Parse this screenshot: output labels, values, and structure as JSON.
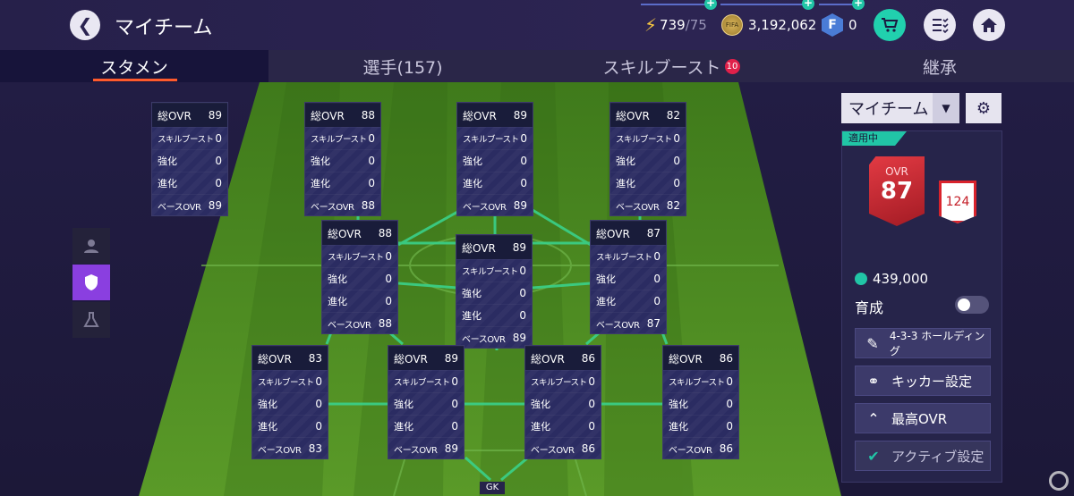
{
  "header": {
    "back_icon": "chevron-left-icon",
    "title": "マイチーム",
    "energy": "739",
    "energy_max": "/75",
    "coins": "3,192,062",
    "coin_icon_text": "FIFA",
    "fp_icon_text": "F",
    "fp": "0",
    "shop_icon": "cart-icon",
    "list_icon": "checklist-icon",
    "home_icon": "home-icon"
  },
  "tabs": [
    {
      "label": "スタメン",
      "badge": ""
    },
    {
      "label": "選手(157)",
      "badge": ""
    },
    {
      "label": "スキルブースト",
      "badge": "10"
    },
    {
      "label": "継承",
      "badge": ""
    }
  ],
  "card_labels": {
    "ovr": "総OVR",
    "skill": "スキルブースト",
    "enhance": "強化",
    "evolve": "進化",
    "base": "ベースOVR"
  },
  "players": [
    {
      "ovr": "89",
      "skill": "0",
      "enhance": "0",
      "evolve": "0",
      "base": "89"
    },
    {
      "ovr": "88",
      "skill": "0",
      "enhance": "0",
      "evolve": "0",
      "base": "88"
    },
    {
      "ovr": "89",
      "skill": "0",
      "enhance": "0",
      "evolve": "0",
      "base": "89"
    },
    {
      "ovr": "82",
      "skill": "0",
      "enhance": "0",
      "evolve": "0",
      "base": "82"
    },
    {
      "ovr": "88",
      "skill": "0",
      "enhance": "0",
      "evolve": "0",
      "base": "88"
    },
    {
      "ovr": "89",
      "skill": "0",
      "enhance": "0",
      "evolve": "0",
      "base": "89"
    },
    {
      "ovr": "87",
      "skill": "0",
      "enhance": "0",
      "evolve": "0",
      "base": "87"
    },
    {
      "ovr": "83",
      "skill": "0",
      "enhance": "0",
      "evolve": "0",
      "base": "83"
    },
    {
      "ovr": "89",
      "skill": "0",
      "enhance": "0",
      "evolve": "0",
      "base": "89"
    },
    {
      "ovr": "86",
      "skill": "0",
      "enhance": "0",
      "evolve": "0",
      "base": "86"
    },
    {
      "ovr": "86",
      "skill": "0",
      "enhance": "0",
      "evolve": "0",
      "base": "86"
    }
  ],
  "gk_label": "GK",
  "side_buttons": [
    "person-icon",
    "shield-icon",
    "flask-icon"
  ],
  "panel": {
    "team_select": "マイチーム",
    "active_tag": "適用中",
    "ovr_label": "OVR",
    "ovr_value": "87",
    "ovr_sub": "124",
    "coins": "439,000",
    "train_label": "育成",
    "train_on": false,
    "buttons": [
      {
        "label": "4-3-3 ホールディング",
        "icon": "edit-icon"
      },
      {
        "label": "キッカー設定",
        "icon": "kicker-icon"
      },
      {
        "label": "最高OVR",
        "icon": "double-chevron-up-icon"
      },
      {
        "label": "アクティブ設定",
        "icon": "check-circle-icon"
      }
    ]
  },
  "colors": {
    "accent_teal": "#21c5a6",
    "tab_underline": "#ff5a2c",
    "badge_red": "#e0204a",
    "ovr_red": "#d9232c",
    "pitch_green": "#4f8f22",
    "pitch_line": "#3ad18a",
    "active_purple": "#8a3fe0"
  }
}
